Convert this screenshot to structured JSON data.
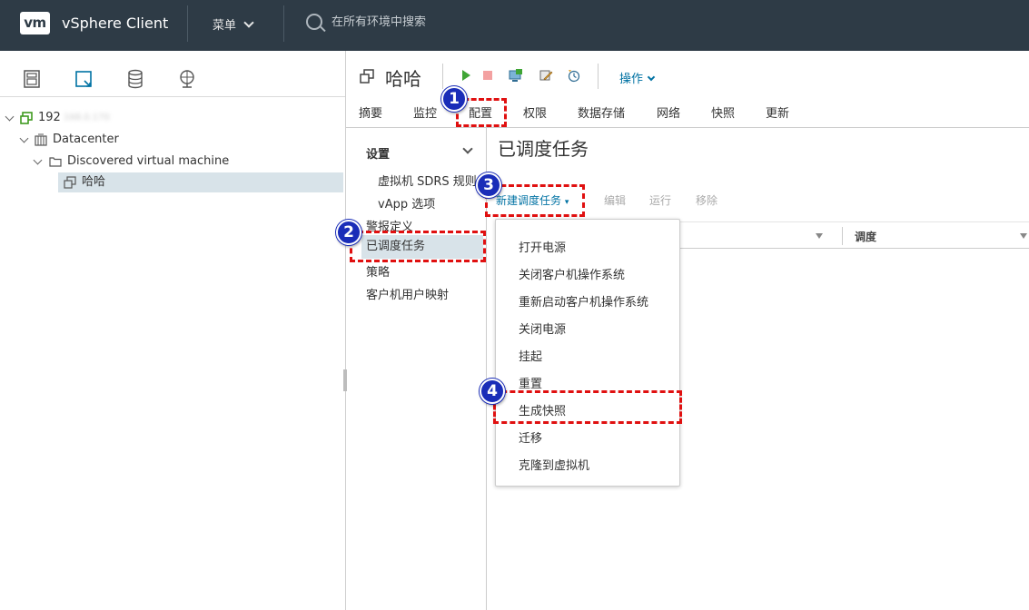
{
  "header": {
    "logo_text": "vm",
    "app_title": "vSphere Client",
    "menu_label": "菜单",
    "search_placeholder": "在所有环境中搜索"
  },
  "navigator": {
    "tabs": [
      "hosts-and-clusters-icon",
      "vms-and-templates-icon",
      "storage-icon",
      "networking-icon"
    ],
    "active_tab": 1,
    "tree": {
      "host_prefix": "192",
      "host_rest": "168.0.170",
      "datacenter": "Datacenter",
      "folder": "Discovered virtual machine",
      "vm": "哈哈"
    }
  },
  "object": {
    "title": "哈哈",
    "actions_label": "操作",
    "toolbar_icons": [
      "power-on-icon",
      "power-off-icon",
      "console-icon",
      "edit-settings-icon",
      "snapshot-icon"
    ]
  },
  "tabs": [
    "摘要",
    "监控",
    "配置",
    "权限",
    "数据存储",
    "网络",
    "快照",
    "更新"
  ],
  "active_tab_index": 2,
  "settings": {
    "header": "设置",
    "items": [
      "虚拟机 SDRS 规则",
      "vApp 选项",
      "警报定义",
      "已调度任务",
      "策略",
      "客户机用户映射"
    ],
    "active_index": 3
  },
  "content": {
    "title": "已调度任务",
    "new_task_label": "新建调度任务",
    "edit_label": "编辑",
    "run_label": "运行",
    "remove_label": "移除",
    "columns": [
      "",
      "调度"
    ]
  },
  "dropdown": {
    "items": [
      "打开电源",
      "关闭客户机操作系统",
      "重新启动客户机操作系统",
      "关闭电源",
      "挂起",
      "重置",
      "生成快照",
      "迁移",
      "克隆到虚拟机"
    ]
  },
  "annotations": [
    "1",
    "2",
    "3",
    "4"
  ],
  "colors": {
    "header_bg": "#2e3b46",
    "accent": "#0072a3",
    "selection": "#d8e3e9",
    "annotation_red": "#e01010",
    "badge_blue": "#1a2db8"
  }
}
